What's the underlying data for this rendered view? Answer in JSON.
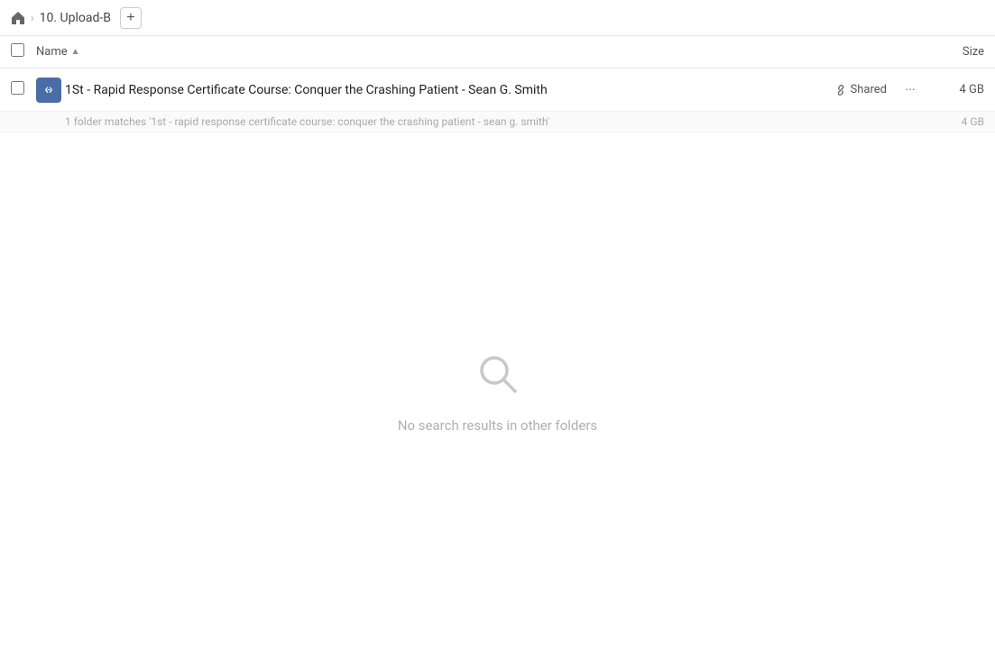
{
  "breadcrumb": {
    "home_title": "Home",
    "current": "10. Upload-B"
  },
  "add_button_label": "+",
  "columns": {
    "name_label": "Name",
    "size_label": "Size"
  },
  "file_row": {
    "name": "1St - Rapid Response Certificate Course: Conquer the Crashing Patient - Sean G. Smith",
    "shared_label": "Shared",
    "size": "4 GB",
    "match_text": "1 folder matches '1st - rapid response certificate course: conquer the crashing patient - sean g. smith'",
    "match_size": "4 GB"
  },
  "empty_state": {
    "text": "No search results in other folders"
  }
}
